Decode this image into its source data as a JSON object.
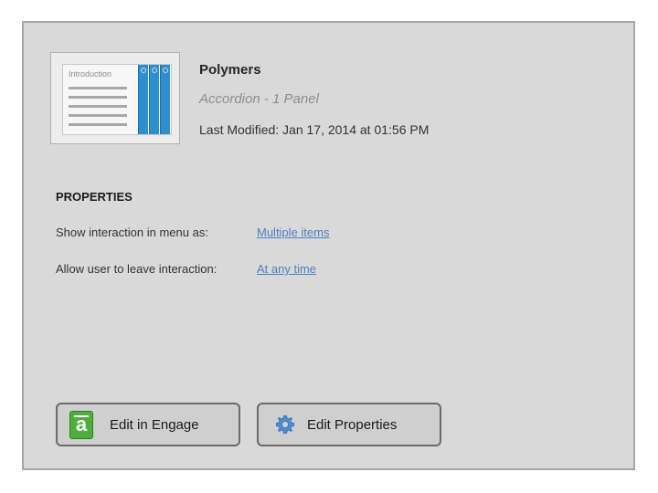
{
  "item": {
    "title": "Polymers",
    "subtitle": "Accordion - 1 Panel",
    "last_modified": "Last Modified: Jan 17, 2014 at 01:56 PM",
    "thumbnail": {
      "intro_label": "Introduction",
      "accent_color": "#2e8fd0"
    }
  },
  "properties": {
    "heading": "PROPERTIES",
    "rows": [
      {
        "label": "Show interaction in menu as:",
        "value": "Multiple items"
      },
      {
        "label": "Allow user to leave interaction:",
        "value": "At any time"
      }
    ]
  },
  "buttons": {
    "edit_engage": {
      "label": "Edit in Engage",
      "icon": "engage-icon",
      "icon_color": "#4caf3c"
    },
    "edit_properties": {
      "label": "Edit Properties",
      "icon": "gear-icon",
      "icon_color": "#4a8fd4"
    }
  }
}
